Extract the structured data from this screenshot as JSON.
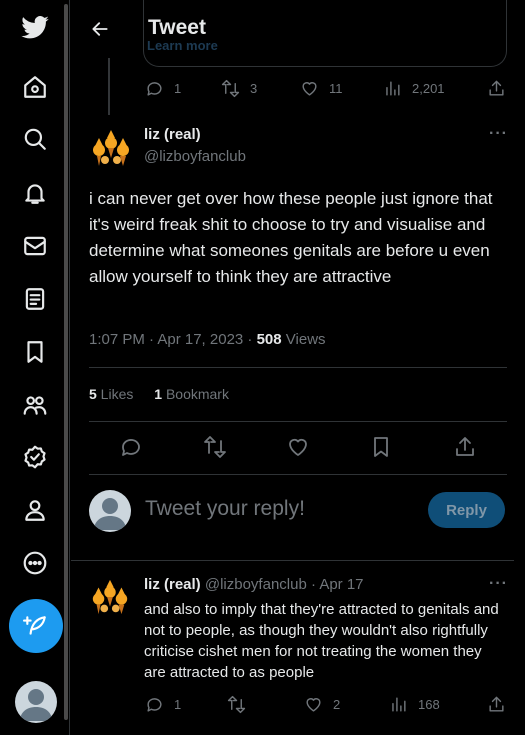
{
  "header": {
    "title": "Tweet",
    "back_label": "back"
  },
  "quoted": {
    "ghost_text": "Learn more"
  },
  "parent_actions": {
    "replies": "1",
    "retweets": "3",
    "likes": "11",
    "views": "2,201"
  },
  "tweet": {
    "name": "liz (real)",
    "handle": "@lizboyfanclub",
    "text": "i can never get over how these people just ignore that it's weird freak shit to choose to try and visualise and determine what someones genitals are before u even allow yourself to think they are attractive",
    "time": "1:07 PM · Apr 17, 2023 · ",
    "views_count": "508",
    "views_label": " Views",
    "likes_count": "5",
    "likes_label": " Likes",
    "bookmarks_count": "1",
    "bookmarks_label": " Bookmark"
  },
  "composer": {
    "placeholder": "Tweet your reply!",
    "button": "Reply"
  },
  "reply": {
    "name": "liz (real)",
    "handle": "@lizboyfanclub",
    "separator": " · ",
    "date": "Apr 17",
    "text": "and also to imply that they're attracted to genitals and not to people, as though they wouldn't also rightfully criticise cishet men for not treating the women they are attracted to as people",
    "replies": "1",
    "retweets": "",
    "likes": "2",
    "views": "168"
  },
  "icons": {
    "nav": [
      "twitter-bird-icon",
      "home-icon",
      "explore-icon",
      "notifications-icon",
      "messages-icon",
      "lists-icon",
      "bookmarks-icon",
      "communities-icon",
      "verified-icon",
      "profile-icon",
      "more-icon",
      "compose-tweet-icon"
    ]
  },
  "colors": {
    "accent": "#1d9bf0",
    "background": "#000000",
    "muted": "#71767b",
    "text": "#e7e9ea"
  }
}
